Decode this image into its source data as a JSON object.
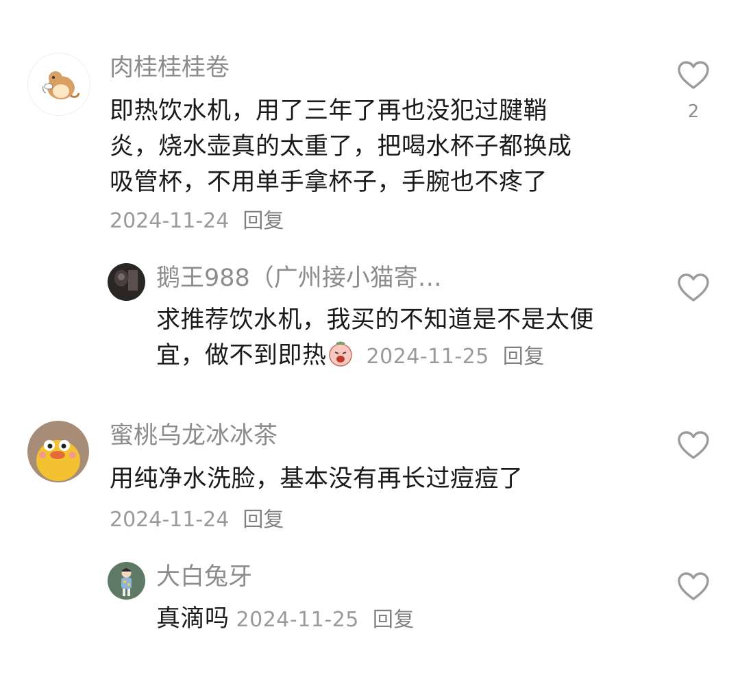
{
  "comments": [
    {
      "nickname": "肉桂桂桂卷",
      "lines": [
        "即热饮水机，用了三年了再也没犯过腱鞘",
        "炎，烧水壶真的太重了，把喝水杯子都换成",
        "吸管杯，不用单手拿杯子，手腕也不疼了"
      ],
      "date": "2024-11-24",
      "reply_label": "回复",
      "likes": "2",
      "avatar_icon": "hamster-avatar-icon"
    },
    {
      "nickname": "鹅王988（广州接小猫寄…",
      "lines": [
        "求推荐饮水机，我买的不知道是不是太便",
        "宜，做不到即热"
      ],
      "emoji": "crying-face-emoji-icon",
      "date": "2024-11-25",
      "reply_label": "回复",
      "avatar_icon": "dark-photo-avatar-icon"
    },
    {
      "nickname": "蜜桃乌龙冰冰茶",
      "lines": [
        "用纯净水洗脸，基本没有再长过痘痘了"
      ],
      "date": "2024-11-24",
      "reply_label": "回复",
      "avatar_icon": "yellow-duck-avatar-icon"
    },
    {
      "nickname": "大白兔牙",
      "lines": [
        "真滴吗"
      ],
      "date": "2024-11-25",
      "reply_label": "回复",
      "avatar_icon": "girl-illustration-avatar-icon"
    }
  ],
  "colors": {
    "nickname": "#8c8c8c",
    "text": "#1a1a1a",
    "meta": "#9a9a9a",
    "icon": "#9b9b9b"
  }
}
